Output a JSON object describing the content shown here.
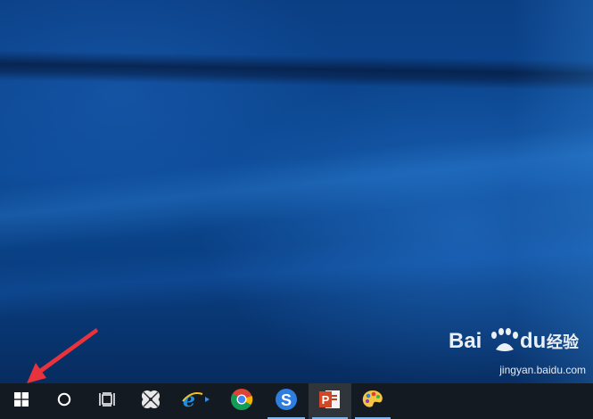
{
  "desktop": {
    "wallpaper": "windows-10-hero-blue"
  },
  "annotation": {
    "color": "#e8323c",
    "shape": "arrow"
  },
  "watermark": {
    "brand": "Baidu经验",
    "url": "jingyan.baidu.com"
  },
  "taskbar": {
    "background": "#141a22",
    "items": [
      {
        "name": "start-button",
        "icon": "windows-logo-icon"
      },
      {
        "name": "search-button",
        "icon": "cortana-circle-icon"
      },
      {
        "name": "task-view-button",
        "icon": "task-view-icon"
      },
      {
        "name": "app-pinned-1",
        "icon": "clover-app-icon",
        "running": false
      },
      {
        "name": "app-internet-explorer",
        "icon": "internet-explorer-icon",
        "running": false
      },
      {
        "name": "app-chrome",
        "icon": "chrome-icon",
        "running": false
      },
      {
        "name": "app-sogou-browser",
        "icon": "sogou-icon",
        "running": true
      },
      {
        "name": "app-powerpoint",
        "icon": "powerpoint-icon",
        "running": true,
        "active": true
      },
      {
        "name": "app-paint",
        "icon": "paint-palette-icon",
        "running": true
      }
    ]
  }
}
